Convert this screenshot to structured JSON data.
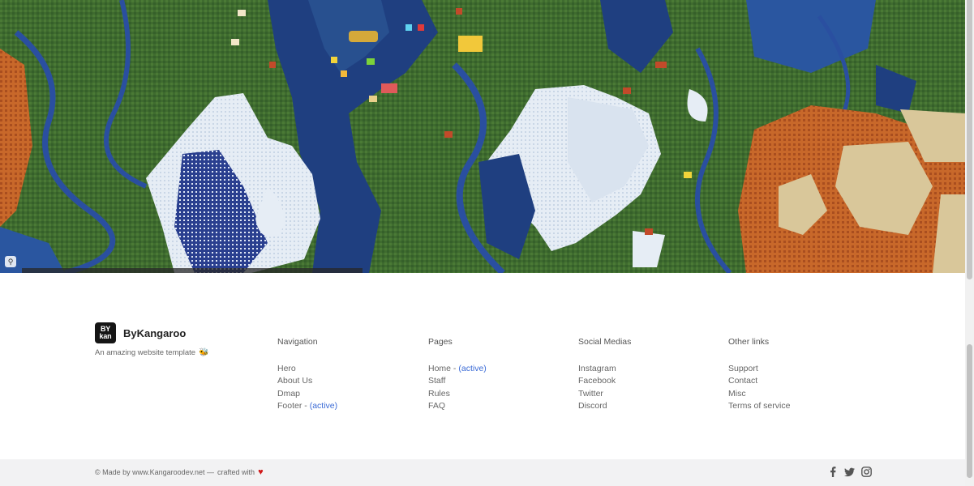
{
  "brand": {
    "logo_top": "BY",
    "logo_bottom": "kan",
    "name": "ByKangaroo",
    "tagline": "An amazing website template"
  },
  "columns": [
    {
      "title": "Navigation",
      "links": [
        {
          "label": "Hero"
        },
        {
          "label": "About Us"
        },
        {
          "label": "Dmap"
        },
        {
          "label": "Footer",
          "active": "(active)"
        }
      ]
    },
    {
      "title": "Pages",
      "links": [
        {
          "label": "Home",
          "active": "(active)"
        },
        {
          "label": "Staff"
        },
        {
          "label": "Rules"
        },
        {
          "label": "FAQ"
        }
      ]
    },
    {
      "title": "Social Medias",
      "links": [
        {
          "label": "Instagram"
        },
        {
          "label": "Facebook"
        },
        {
          "label": "Twitter"
        },
        {
          "label": "Discord"
        }
      ]
    },
    {
      "title": "Other links",
      "links": [
        {
          "label": "Support"
        },
        {
          "label": "Contact"
        },
        {
          "label": "Misc"
        },
        {
          "label": "Terms of service"
        }
      ]
    }
  ],
  "footer_bottom": {
    "made_by": "© Made by www.Kangaroodev.net —",
    "crafted": "crafted with",
    "socials": [
      "facebook-icon",
      "twitter-icon",
      "instagram-icon"
    ]
  },
  "colors": {
    "active_link": "#3b6bd6",
    "heart": "#d11a1a",
    "map_ocean": "#1f3f80",
    "map_land": "#3f6b2f",
    "map_snow": "#e8eef5",
    "map_badlands": "#c8682a"
  }
}
